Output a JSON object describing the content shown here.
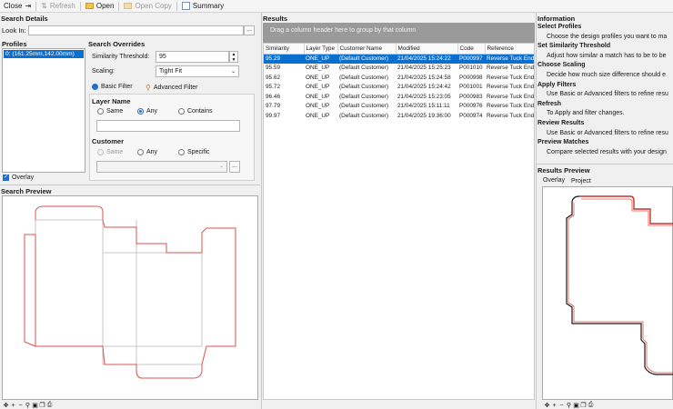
{
  "toolbar": {
    "close_label": "Close",
    "refresh_label": "Refresh",
    "open_label": "Open",
    "open_copy_label": "Open Copy",
    "summary_label": "Summary"
  },
  "search_details": {
    "title": "Search Details",
    "look_in_label": "Look In:",
    "look_in_value": "",
    "browse_label": "...",
    "profiles_label": "Profiles",
    "profiles": [
      "0: (161.25mm,142.00mm)"
    ],
    "overlay_label": "Overlay",
    "overlay_checked": true
  },
  "search_overrides": {
    "title": "Search Overrides",
    "similarity_label": "Similarity Threshold:",
    "similarity_value": "95",
    "scaling_label": "Scaling:",
    "scaling_value": "Tight Fit",
    "tabs": [
      "Basic Filter",
      "Advanced Filter"
    ],
    "layer_name_title": "Layer Name",
    "layer_options": [
      "Same",
      "Any",
      "Contains"
    ],
    "layer_selected": "Any",
    "customer_title": "Customer",
    "customer_options": [
      "Same",
      "Any",
      "Specific"
    ],
    "customer_selected": "",
    "customer_browse": "..."
  },
  "search_preview": {
    "title": "Search Preview"
  },
  "results": {
    "title": "Results",
    "group_hint": "Drag a column header here to group by that column",
    "columns": [
      "Similarity",
      "Layer Type",
      "Customer Name",
      "Modified",
      "Code",
      "Reference"
    ],
    "rows": [
      [
        "95.29",
        "ONE_UP",
        "(Default Customer)",
        "21/04/2025 15:24:22",
        "P000997",
        "Reverse Tuck End"
      ],
      [
        "95.59",
        "ONE_UP",
        "(Default Customer)",
        "21/04/2025 15:25:23",
        "P001010",
        "Reverse Tuck End"
      ],
      [
        "95.62",
        "ONE_UP",
        "(Default Customer)",
        "21/04/2025 15:24:58",
        "P000998",
        "Reverse Tuck End"
      ],
      [
        "95.72",
        "ONE_UP",
        "(Default Customer)",
        "21/04/2025 15:24:42",
        "P001001",
        "Reverse Tuck End"
      ],
      [
        "96.46",
        "ONE_UP",
        "(Default Customer)",
        "21/04/2025 15:23:05",
        "P000983",
        "Reverse Tuck End"
      ],
      [
        "97.79",
        "ONE_UP",
        "(Default Customer)",
        "21/04/2025 15:11:11",
        "P000976",
        "Reverse Tuck End"
      ],
      [
        "99.97",
        "ONE_UP",
        "(Default Customer)",
        "21/04/2025 19:36:00",
        "P000974",
        "Reverse Tuck End"
      ]
    ],
    "selected_row": 0
  },
  "information": {
    "title": "Information",
    "items": [
      {
        "heading": "Select Profiles",
        "text": "Choose the design profiles you want to ma"
      },
      {
        "heading": "Set Similarity Threshold",
        "text": "Adjust how similar a match has to be to be"
      },
      {
        "heading": "Choose Scaling",
        "text": "Decide how much size difference should e"
      },
      {
        "heading": "Apply Filters",
        "text": "Use Basic or Advanced filters to refine resu"
      },
      {
        "heading": "Refresh",
        "text": "To Apply and filter changes."
      },
      {
        "heading": "Review Results",
        "text": "Use Basic or Advanced filters to refine resu"
      },
      {
        "heading": "Preview Matches",
        "text": "Compare selected results with your design"
      }
    ]
  },
  "results_preview": {
    "title": "Results Preview",
    "tabs": [
      "Overlay",
      "Project"
    ]
  },
  "colors": {
    "selection": "#0b6fd0",
    "dieline_cut": "#d9534f",
    "dieline_crease": "#b0b0b0"
  }
}
